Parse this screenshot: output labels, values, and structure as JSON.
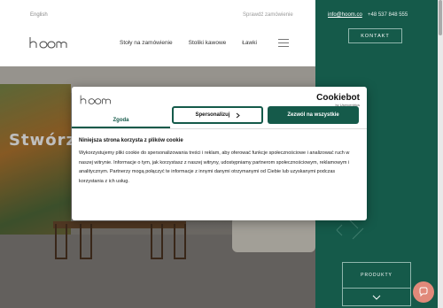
{
  "header": {
    "language": "English",
    "check_order": "Sprawdź zamówienie",
    "nav": [
      "Stoły na zamówienie",
      "Stoliki kawowe",
      "Ławki"
    ]
  },
  "contact": {
    "email": "info@hoom.co",
    "phone": "+48 537 848 555",
    "kontakt_label": "KONTAKT"
  },
  "hero": {
    "title_partial": "Stwórz"
  },
  "side": {
    "produkty_label": "PRODUKTY"
  },
  "cookie_dialog": {
    "brand": "Cookiebot",
    "brand_sub": "by Usercentrics",
    "tabs": [
      "Zgoda",
      "Szczegóły",
      "O plikach cookies"
    ],
    "active_tab": "Zgoda",
    "heading": "Niniejsza strona korzysta z plików cookie",
    "body": "Wykorzystujemy pliki cookie do spersonalizowania treści i reklam, aby oferować funkcje społecznościowe i analizować ruch w naszej witrynie. Informacje o tym, jak korzystasz z naszej witryny, udostępniamy partnerom społecznościowym, reklamowym i analitycznym. Partnerzy mogą połączyć te informacje z innymi danymi otrzymanymi od Ciebie lub uzyskanymi podczas korzystania z ich usług.",
    "settings_button": "Spersonalizuj",
    "allow_button": "Zezwól na wszystkie"
  },
  "colors": {
    "brand_green": "#155a4a",
    "chat_bubble": "#e1897a"
  }
}
